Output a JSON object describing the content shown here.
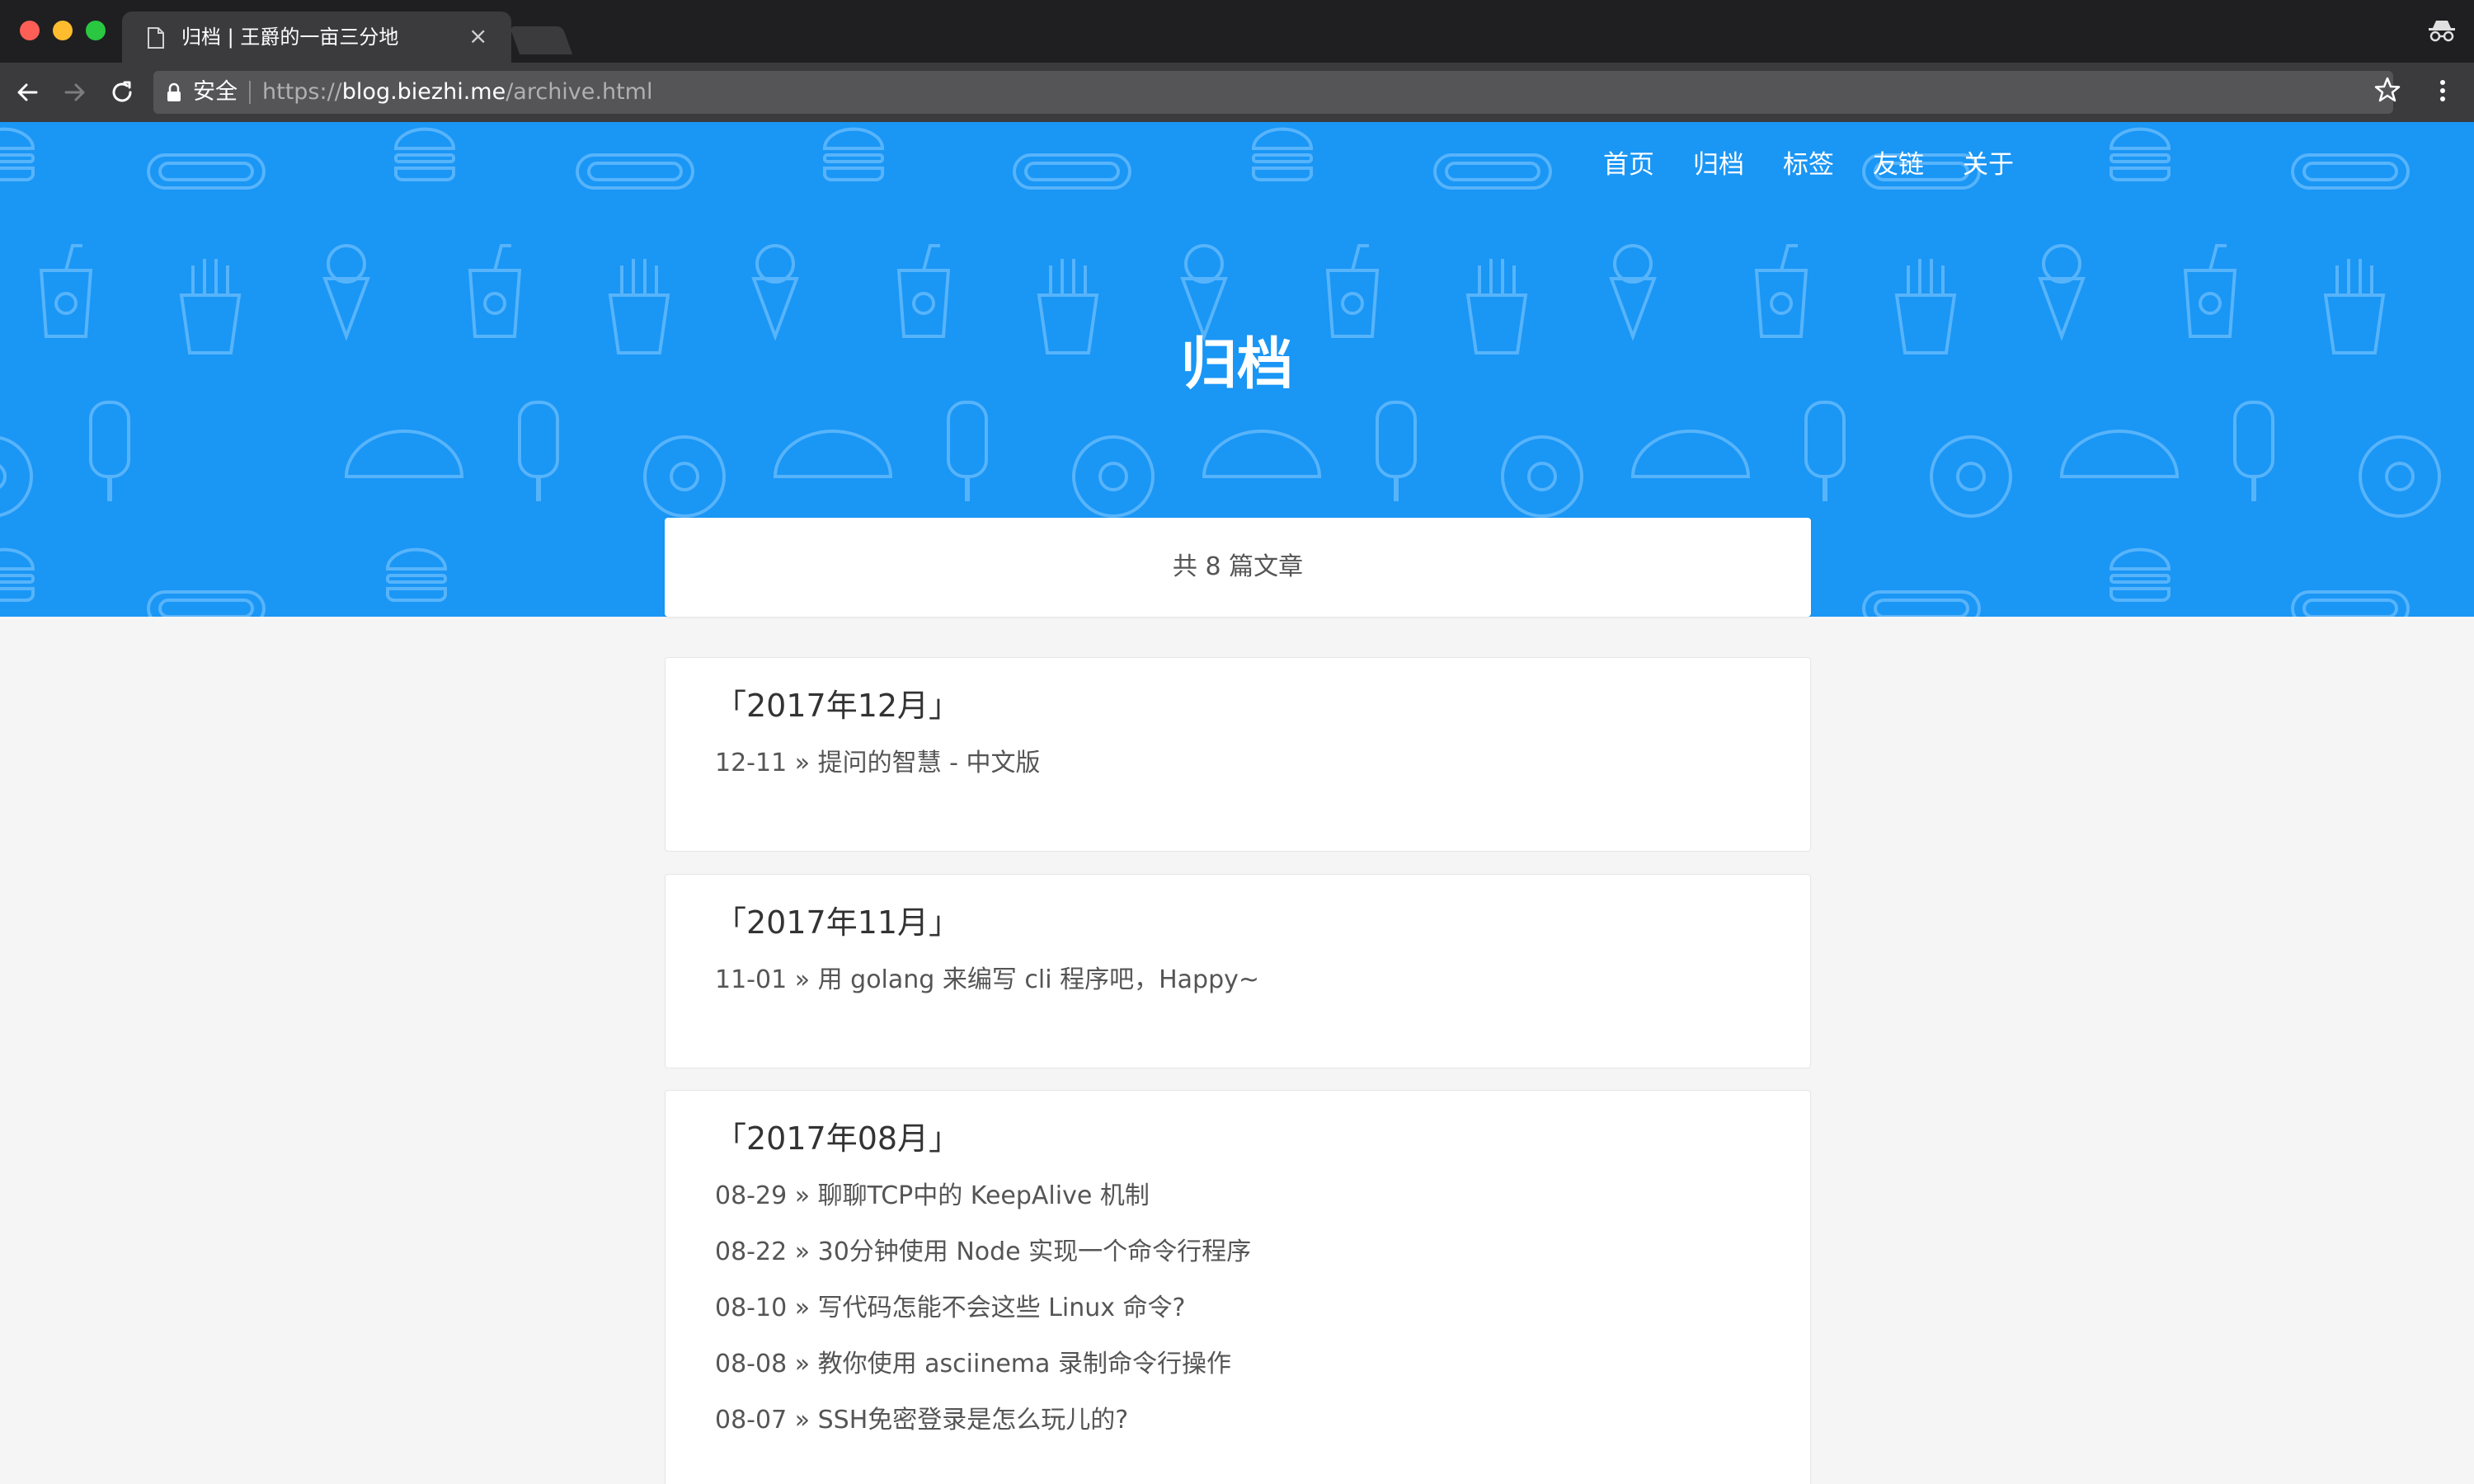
{
  "browser": {
    "tab_title": "归档 | 王爵的一亩三分地",
    "tab_close": "×",
    "secure_label": "安全",
    "url_scheme": "https://",
    "url_host": "blog.biezhi.me",
    "url_path": "/archive.html",
    "icons": [
      "page-icon",
      "back-icon",
      "forward-icon",
      "reload-icon",
      "lock-icon",
      "star-icon",
      "menu-icon",
      "incognito-icon"
    ]
  },
  "site": {
    "nav": [
      "首页",
      "归档",
      "标签",
      "友链",
      "关于"
    ],
    "hero_title": "归档",
    "count_text": "共 8 篇文章",
    "header_color": "#1a96f5"
  },
  "archive": [
    {
      "month": "「2017年12月」",
      "posts": [
        {
          "date": "12-11",
          "title": "提问的智慧 - 中文版"
        }
      ]
    },
    {
      "month": "「2017年11月」",
      "posts": [
        {
          "date": "11-01",
          "title": "用 golang 来编写 cli 程序吧，Happy~"
        }
      ]
    },
    {
      "month": "「2017年08月」",
      "posts": [
        {
          "date": "08-29",
          "title": "聊聊TCP中的 KeepAlive 机制"
        },
        {
          "date": "08-22",
          "title": "30分钟使用 Node 实现一个命令行程序"
        },
        {
          "date": "08-10",
          "title": "写代码怎能不会这些 Linux 命令?"
        },
        {
          "date": "08-08",
          "title": "教你使用 asciinema 录制命令行操作"
        },
        {
          "date": "08-07",
          "title": "SSH免密登录是怎么玩儿的?"
        }
      ]
    }
  ]
}
